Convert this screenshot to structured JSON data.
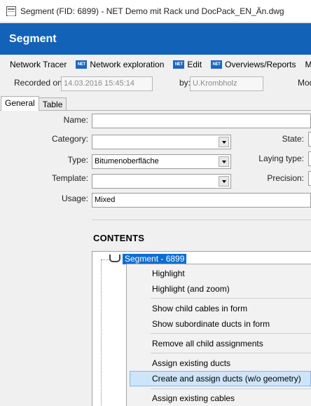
{
  "window": {
    "title": "Segment (FID: 6899) - NET Demo mit Rack und DocPack_EN_Än.dwg"
  },
  "header": {
    "title": "Segment"
  },
  "menubar": {
    "items": [
      {
        "label": "Network Tracer",
        "badge": ""
      },
      {
        "label": "Network exploration",
        "badge": "NET"
      },
      {
        "label": "Edit",
        "badge": "NET"
      },
      {
        "label": "Overviews/Reports",
        "badge": "NET"
      },
      {
        "label": "Mo",
        "badge": ""
      }
    ]
  },
  "recorded": {
    "label": "Recorded on:",
    "value": "14.03.2016 15:45:14",
    "by_label": "by:",
    "by_value": "U.Krombholz",
    "mod_label": "Mod"
  },
  "tabs": [
    {
      "label": "General",
      "active": true
    },
    {
      "label": "Table",
      "active": false
    }
  ],
  "form": {
    "name": {
      "label": "Name:",
      "value": ""
    },
    "category": {
      "label": "Category:",
      "value": ""
    },
    "type": {
      "label": "Type:",
      "value": "Bitumenoberfläche"
    },
    "template": {
      "label": "Template:",
      "value": ""
    },
    "usage": {
      "label": "Usage:",
      "value": "Mixed"
    },
    "state": {
      "label": "State:"
    },
    "laying_type": {
      "label": "Laying type:"
    },
    "precision": {
      "label": "Precision:"
    }
  },
  "contents": {
    "title": "CONTENTS",
    "root_node": "Segment - 6899"
  },
  "context_menu": {
    "items": [
      {
        "label": "Highlight",
        "hover": false
      },
      {
        "label": "Highlight (and zoom)",
        "hover": false
      },
      {
        "label": "Show child cables in form",
        "hover": false
      },
      {
        "label": "Show subordinate ducts in form",
        "hover": false
      },
      {
        "label": "Remove all child assignments",
        "hover": false
      },
      {
        "label": "Assign existing ducts",
        "hover": false
      },
      {
        "label": "Create and assign ducts (w/o geometry)",
        "hover": true
      },
      {
        "label": "Assign existing cables",
        "hover": false
      }
    ]
  },
  "colors": {
    "header_bg": "#1263b8",
    "selection_bg": "#0b6fd1",
    "menu_hover_bg": "#cde5fa"
  }
}
